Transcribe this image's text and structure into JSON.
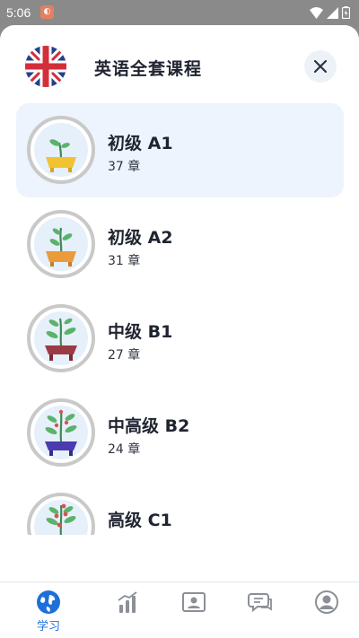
{
  "status_bar": {
    "time": "5:06"
  },
  "header": {
    "title": "英语全套课程"
  },
  "courses": [
    {
      "name": "初级 A1",
      "chapters": "37 章",
      "selected": true
    },
    {
      "name": "初级 A2",
      "chapters": "31 章",
      "selected": false
    },
    {
      "name": "中级 B1",
      "chapters": "27 章",
      "selected": false
    },
    {
      "name": "中高级 B2",
      "chapters": "24 章",
      "selected": false
    },
    {
      "name": "高级 C1",
      "chapters": "",
      "selected": false
    }
  ],
  "bottom_nav": {
    "items": [
      {
        "icon": "globe-icon",
        "label": "学习",
        "active": true
      },
      {
        "icon": "chart-icon",
        "label": "",
        "active": false
      },
      {
        "icon": "profile-card-icon",
        "label": "",
        "active": false
      },
      {
        "icon": "chat-icon",
        "label": "",
        "active": false
      },
      {
        "icon": "user-icon",
        "label": "",
        "active": false
      }
    ]
  },
  "colors": {
    "accent": "#1f6fd8",
    "selected_bg": "#eef4fd",
    "close_bg": "#edf2f9"
  }
}
